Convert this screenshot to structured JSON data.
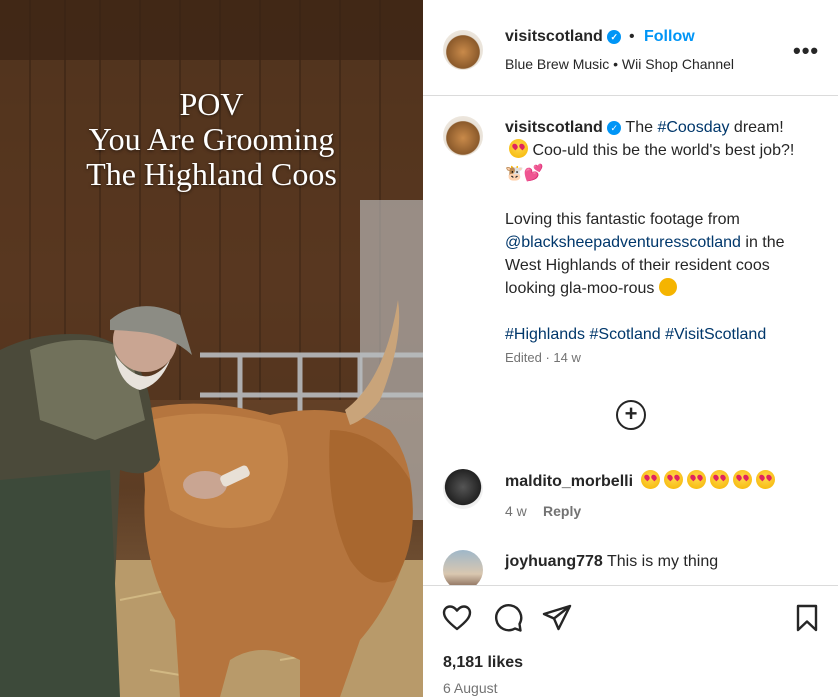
{
  "media": {
    "overlay_lines": [
      "POV",
      "You Are Grooming",
      "The Highland Coos"
    ]
  },
  "header": {
    "username": "visitscotland",
    "separator": "•",
    "follow_label": "Follow",
    "audio": "Blue Brew Music • Wii Shop Channel",
    "more_label": "•••"
  },
  "caption": {
    "username": "visitscotland",
    "text_1": "The ",
    "hashtag_1": "#Coosday",
    "text_2": " dream!",
    "text_3": " Coo-uld this be the world's best job?!",
    "text_4": "Loving this fantastic footage from ",
    "mention": "@blacksheepadventuresscotland",
    "text_5": " in the West Highlands of their resident coos looking gla-moo-rous",
    "hashtags": "#Highlands #Scotland #VisitScotland",
    "edited": "Edited · 14 w"
  },
  "load_more_label": "+",
  "comments": [
    {
      "username": "maldito_morbelli",
      "text": "",
      "time": "4 w",
      "reply_label": "Reply"
    },
    {
      "username": "joyhuang778",
      "text": " This is my thing"
    }
  ],
  "footer": {
    "likes": "8,181 likes",
    "date": "6 August"
  },
  "colors": {
    "accent": "#0095f6",
    "link": "#00376b",
    "muted": "#737373"
  }
}
